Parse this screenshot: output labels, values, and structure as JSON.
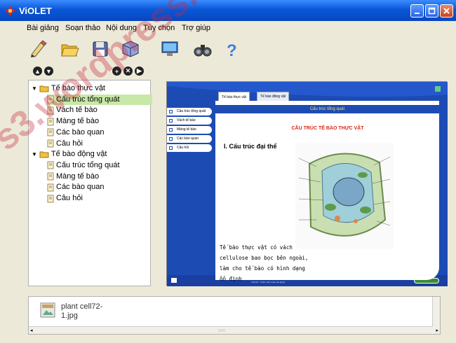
{
  "window": {
    "title": "ViOLET"
  },
  "menu": [
    {
      "id": "bai-giang",
      "label": "Bài giảng"
    },
    {
      "id": "soan-thao",
      "label": "Soạn thảo"
    },
    {
      "id": "noi-dung",
      "label": "Nội dung"
    },
    {
      "id": "tuy-chon",
      "label": "Tùy chọn"
    },
    {
      "id": "tro-giup",
      "label": "Trợ giúp"
    }
  ],
  "toolbar": {
    "icons": [
      "edit-icon",
      "open-folder-icon",
      "save-icon",
      "package-icon",
      "screen-preview-icon",
      "binoculars-icon",
      "help-icon"
    ]
  },
  "tree": {
    "nodes": [
      {
        "label": "Tế bào thực vật",
        "level": 0,
        "type": "folder"
      },
      {
        "label": "Cấu trúc tổng quát",
        "level": 1,
        "type": "page",
        "selected": true
      },
      {
        "label": "Vách tế bào",
        "level": 1,
        "type": "page"
      },
      {
        "label": "Màng tế bào",
        "level": 1,
        "type": "page"
      },
      {
        "label": "Các bào quan",
        "level": 1,
        "type": "page"
      },
      {
        "label": "Câu hỏi",
        "level": 1,
        "type": "page"
      },
      {
        "label": "Tế bào động vật",
        "level": 0,
        "type": "folder"
      },
      {
        "label": "Cấu trúc tổng quát",
        "level": 1,
        "type": "page"
      },
      {
        "label": "Màng tế bào",
        "level": 1,
        "type": "page"
      },
      {
        "label": "Các bào quan",
        "level": 1,
        "type": "page"
      },
      {
        "label": "Câu hỏi",
        "level": 1,
        "type": "page"
      }
    ]
  },
  "preview": {
    "tabs": [
      "Tế bào thực vật",
      "Tế bào động vật"
    ],
    "side_menu": [
      "Cấu trúc tổng quát",
      "Vách tế bào",
      "Màng tế bào",
      "Các bào quan",
      "Câu hỏi"
    ],
    "slide": {
      "header": "Cấu trúc tổng quát",
      "title": "CẤU TRÚC TẾ BÀO THỰC VẬT",
      "heading": "I. Cấu trúc đại thể",
      "body": "Tế bào thực vật có vách cellulose bao bọc bên ngoài, làm cho tế bào có hình dạng ổn định"
    },
    "footer_text": "VIOLET - Phần mềm soạn bài giảng",
    "accent_color": "#1c4bb4"
  },
  "files": {
    "items": [
      {
        "name": "plant cell72-1.jpg",
        "name_line1": "plant cell72-",
        "name_line2": "1.jpg"
      }
    ]
  },
  "watermark": "s3.wordpress.c"
}
